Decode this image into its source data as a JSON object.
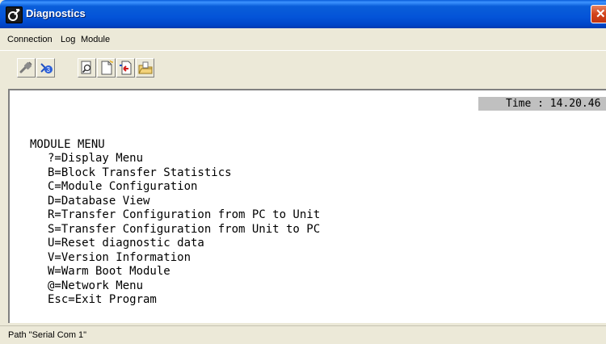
{
  "window": {
    "title": "Diagnostics",
    "close_glyph": "✕"
  },
  "menubar": {
    "items": [
      {
        "label": "Connection"
      },
      {
        "label": "Log"
      },
      {
        "label": "Module"
      }
    ]
  },
  "toolbar": {
    "buttons": [
      {
        "icon": "disconnect-plug-icon"
      },
      {
        "icon": "connect-icon"
      },
      {
        "icon": "find-icon"
      },
      {
        "icon": "new-file-icon"
      },
      {
        "icon": "file-transfer-icon"
      },
      {
        "icon": "open-file-icon"
      }
    ]
  },
  "terminal": {
    "time_text": "Time : 14.20.46",
    "menu_title": "MODULE MENU",
    "options": [
      "?=Display Menu",
      "B=Block Transfer Statistics",
      "C=Module Configuration",
      "D=Database View",
      "R=Transfer Configuration from PC to Unit",
      "S=Transfer Configuration from Unit to PC",
      "U=Reset diagnostic data",
      "V=Version Information",
      "W=Warm Boot Module",
      "@=Network Menu",
      "Esc=Exit Program"
    ]
  },
  "statusbar": {
    "path_text": "Path \"Serial Com 1\""
  },
  "colors": {
    "titlebar": "#0454d8",
    "close_button": "#d2431c",
    "window_face": "#ece9d8",
    "terminal_bg": "#ffffff",
    "time_box_bg": "#c0c0c0"
  }
}
